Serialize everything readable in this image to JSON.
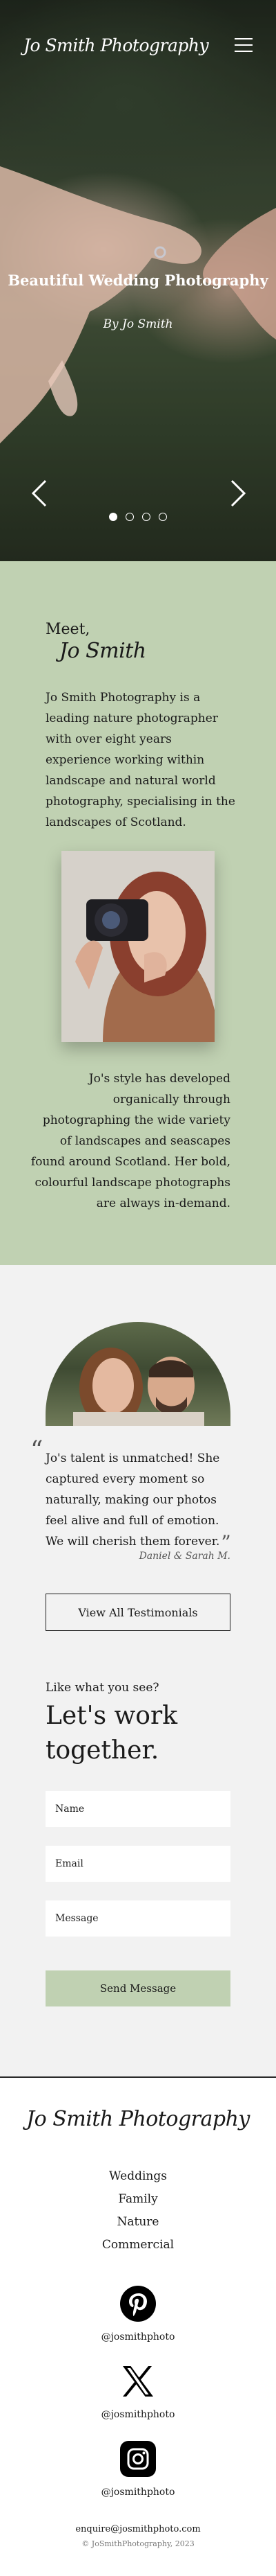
{
  "header": {
    "logo": "Jo Smith Photography",
    "menu_icon": "hamburger-menu-icon"
  },
  "hero": {
    "title": "Beautiful Wedding Photography",
    "subtitle": "By Jo Smith",
    "slides": 4,
    "active_slide": 1,
    "prev_icon": "chevron-left-icon",
    "next_icon": "chevron-right-icon"
  },
  "intro": {
    "meet": "Meet,",
    "name": "Jo Smith",
    "text": "Jo Smith Photography is a leading nature photographer with over eight years experience working within landscape and natural world photography, specialising in the landscapes of Scotland.",
    "text2": "Jo's style has developed organically through photographing the wide variety of landscapes and seascapes found around Scotland. Her bold, colourful landscape photographs are always in-demand."
  },
  "testimonial": {
    "quote": "Jo's talent is unmatched! She captured every moment so naturally, making our photos feel alive and full of emotion. We will cherish them forever.",
    "author": "Daniel & Sarah M.",
    "button": "View All Testimonials"
  },
  "contact": {
    "kicker": "Like what you see?",
    "heading": "Let's work together.",
    "name_placeholder": "Name",
    "email_placeholder": "Email",
    "message_placeholder": "Message",
    "send": "Send Message"
  },
  "footer": {
    "logo": "Jo Smith Photography",
    "nav": [
      "Weddings",
      "Family",
      "Nature",
      "Commercial"
    ],
    "social": [
      {
        "icon": "pinterest-icon",
        "handle": "@josmithphoto"
      },
      {
        "icon": "x-icon",
        "handle": "@josmithphoto"
      },
      {
        "icon": "instagram-icon",
        "handle": "@josmithphoto"
      }
    ],
    "email": "enquire@josmithphoto.com",
    "copyright": "© JoSmithPhotography, 2023"
  },
  "colors": {
    "sage": "#c0d1b2",
    "background": "#f2f2f2",
    "text": "#1a1a1a"
  }
}
